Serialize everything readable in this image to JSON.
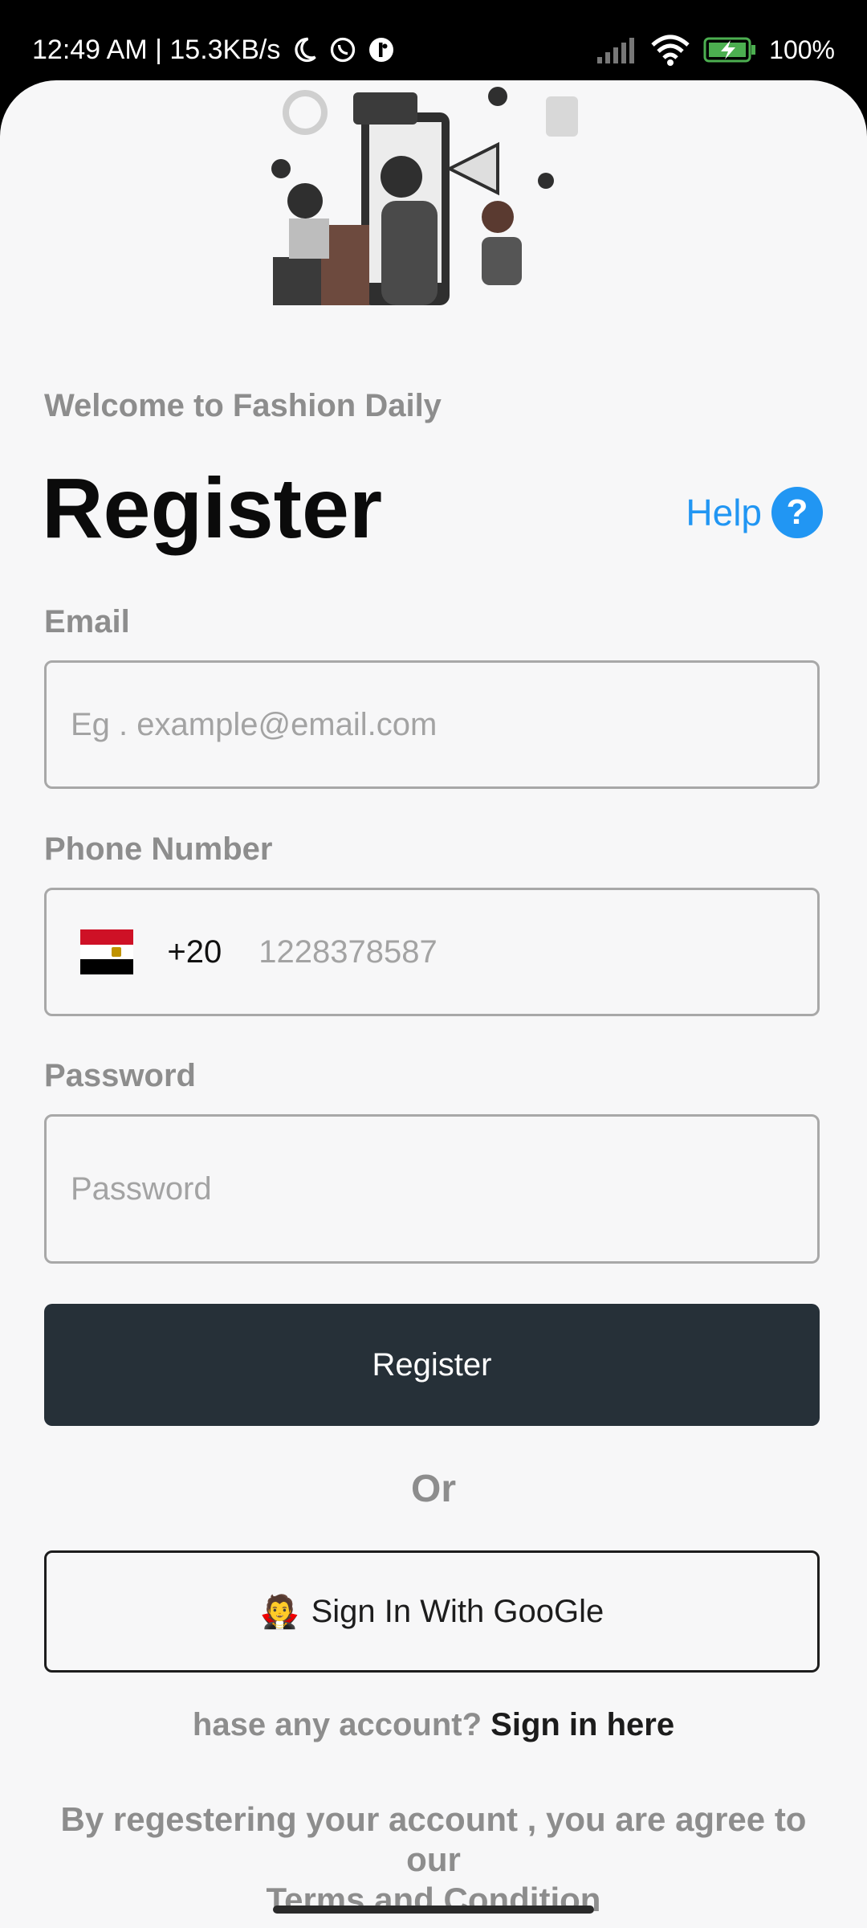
{
  "status_bar": {
    "time_speed": "12:49 AM | 15.3KB/s",
    "battery": "100%"
  },
  "content": {
    "welcome": "Welcome to Fashion Daily",
    "title": "Register",
    "help_label": "Help",
    "help_icon_glyph": "?"
  },
  "form": {
    "email_label": "Email",
    "email_placeholder": "Eg . example@email.com",
    "phone_label": "Phone Number",
    "phone_dial_code": "+20",
    "phone_placeholder": "1228378587",
    "password_label": "Password",
    "password_placeholder": "Password",
    "register_button": "Register"
  },
  "alt_auth": {
    "or_text": "Or",
    "google_icon": "🧛",
    "google_button": "Sign In With GooGle",
    "account_prompt": "hase any account?",
    "sign_in_link": "Sign in here"
  },
  "terms": {
    "line1": "By regestering your account , you are agree to our",
    "line2": "Terms and Condition"
  },
  "colors": {
    "accent": "#2196f3",
    "primary_button": "#263038",
    "background": "#f7f7f8"
  }
}
